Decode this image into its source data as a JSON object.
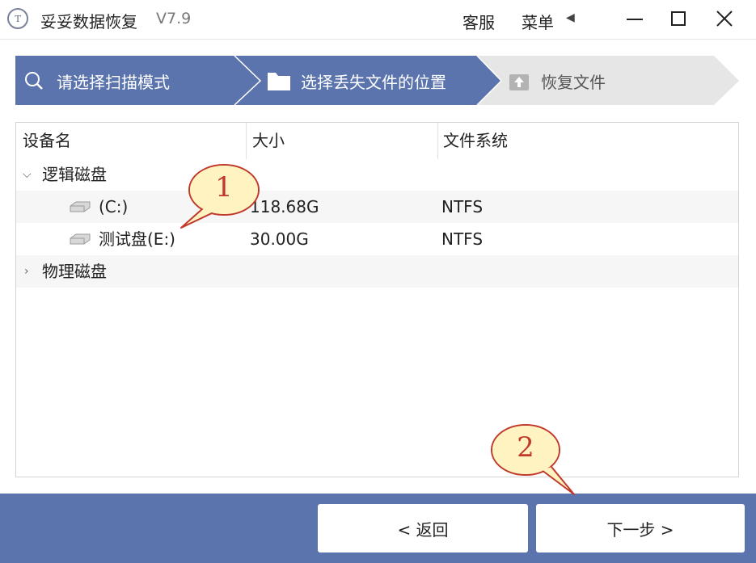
{
  "titlebar": {
    "logo_text": "T",
    "app_title": "妥妥数据恢复",
    "version": "V7.9",
    "support": "客服",
    "menu": "菜单",
    "menu_arrow": "◀"
  },
  "wizard": {
    "steps": [
      {
        "label": "请选择扫描模式",
        "icon": "search-icon",
        "state": "done"
      },
      {
        "label": "选择丢失文件的位置",
        "icon": "folder-icon",
        "state": "active"
      },
      {
        "label": "恢复文件",
        "icon": "upload-icon",
        "state": "pending"
      }
    ]
  },
  "table": {
    "columns": [
      "设备名",
      "大小",
      "文件系统"
    ],
    "groups": [
      {
        "label": "逻辑磁盘",
        "expanded": true,
        "drives": [
          {
            "name": "(C:)",
            "size": "118.68G",
            "fs": "NTFS"
          },
          {
            "name": "测试盘(E:)",
            "size": "30.00G",
            "fs": "NTFS"
          }
        ]
      },
      {
        "label": "物理磁盘",
        "expanded": false
      }
    ]
  },
  "callouts": [
    "1",
    "2"
  ],
  "buttons": {
    "back": "< 返回",
    "next": "下一步 >"
  },
  "colors": {
    "accent": "#5b74ad",
    "step_pending": "#e6e6e6",
    "callout_fill": "#fff3c2",
    "callout_border": "#c0392b"
  }
}
